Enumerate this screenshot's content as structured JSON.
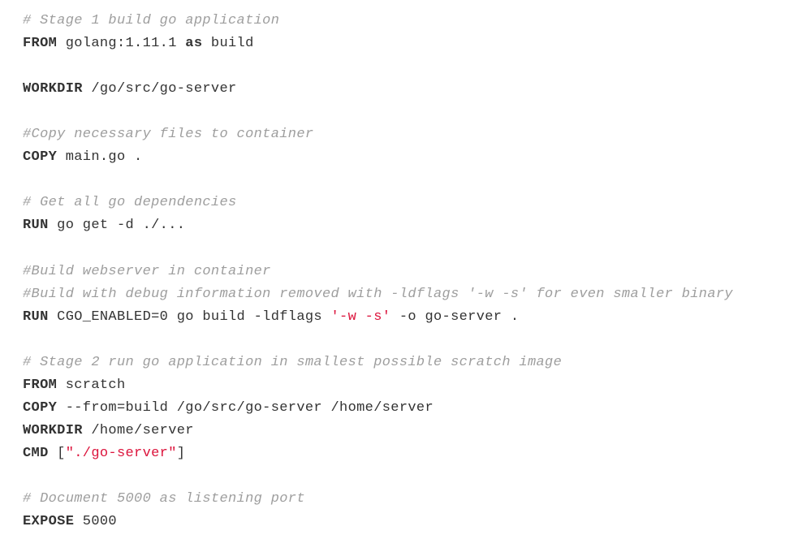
{
  "lines": [
    {
      "type": "comment",
      "text": "# Stage 1 build go application"
    },
    {
      "type": "mixed",
      "parts": [
        {
          "cls": "keyword",
          "text": "FROM"
        },
        {
          "cls": "normal",
          "text": " golang:1.11.1 "
        },
        {
          "cls": "keyword",
          "text": "as"
        },
        {
          "cls": "normal",
          "text": " build"
        }
      ]
    },
    {
      "type": "blank"
    },
    {
      "type": "mixed",
      "parts": [
        {
          "cls": "keyword",
          "text": "WORKDIR"
        },
        {
          "cls": "normal",
          "text": " /go/src/go-server"
        }
      ]
    },
    {
      "type": "blank"
    },
    {
      "type": "comment",
      "text": "#Copy necessary files to container"
    },
    {
      "type": "mixed",
      "parts": [
        {
          "cls": "keyword",
          "text": "COPY"
        },
        {
          "cls": "normal",
          "text": " main.go ."
        }
      ]
    },
    {
      "type": "blank"
    },
    {
      "type": "comment",
      "text": "# Get all go dependencies"
    },
    {
      "type": "mixed",
      "parts": [
        {
          "cls": "keyword",
          "text": "RUN"
        },
        {
          "cls": "normal",
          "text": " go get -d ./..."
        }
      ]
    },
    {
      "type": "blank"
    },
    {
      "type": "comment",
      "text": "#Build webserver in container"
    },
    {
      "type": "comment",
      "text": "#Build with debug information removed with -ldflags '-w -s' for even smaller binary"
    },
    {
      "type": "mixed",
      "parts": [
        {
          "cls": "keyword",
          "text": "RUN"
        },
        {
          "cls": "normal",
          "text": " CGO_ENABLED=0 go build -ldflags "
        },
        {
          "cls": "string",
          "text": "'-w -s'"
        },
        {
          "cls": "normal",
          "text": " -o go-server ."
        }
      ]
    },
    {
      "type": "blank"
    },
    {
      "type": "comment",
      "text": "# Stage 2 run go application in smallest possible scratch image"
    },
    {
      "type": "mixed",
      "parts": [
        {
          "cls": "keyword",
          "text": "FROM"
        },
        {
          "cls": "normal",
          "text": " scratch"
        }
      ]
    },
    {
      "type": "mixed",
      "parts": [
        {
          "cls": "keyword",
          "text": "COPY"
        },
        {
          "cls": "normal",
          "text": " --from=build /go/src/go-server /home/server"
        }
      ]
    },
    {
      "type": "mixed",
      "parts": [
        {
          "cls": "keyword",
          "text": "WORKDIR"
        },
        {
          "cls": "normal",
          "text": " /home/server"
        }
      ]
    },
    {
      "type": "mixed",
      "parts": [
        {
          "cls": "keyword",
          "text": "CMD"
        },
        {
          "cls": "normal",
          "text": " ["
        },
        {
          "cls": "string",
          "text": "\"./go-server\""
        },
        {
          "cls": "normal",
          "text": "]"
        }
      ]
    },
    {
      "type": "blank"
    },
    {
      "type": "comment",
      "text": "# Document 5000 as listening port"
    },
    {
      "type": "mixed",
      "parts": [
        {
          "cls": "keyword",
          "text": "EXPOSE"
        },
        {
          "cls": "normal",
          "text": " 5000"
        }
      ]
    }
  ]
}
